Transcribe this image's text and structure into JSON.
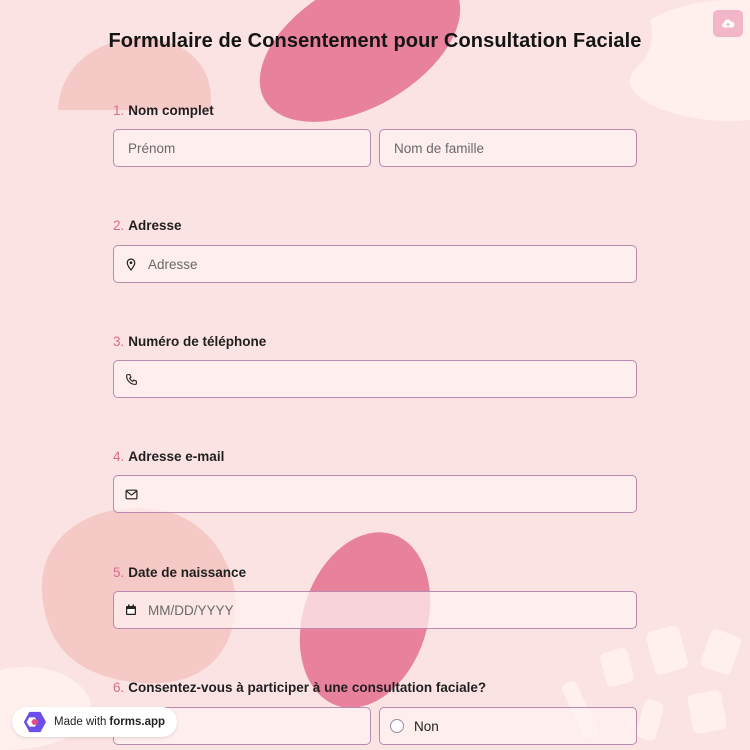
{
  "form": {
    "title": "Formulaire de Consentement pour Consultation Faciale",
    "questions": [
      {
        "number": "1.",
        "label": "Nom complet",
        "fields": [
          {
            "placeholder": "Prénom"
          },
          {
            "placeholder": "Nom de famille"
          }
        ]
      },
      {
        "number": "2.",
        "label": "Adresse",
        "fields": [
          {
            "placeholder": "Adresse",
            "icon": "location-pin-icon"
          }
        ]
      },
      {
        "number": "3.",
        "label": "Numéro de téléphone",
        "fields": [
          {
            "placeholder": "",
            "icon": "phone-icon"
          }
        ]
      },
      {
        "number": "4.",
        "label": "Adresse e-mail",
        "fields": [
          {
            "placeholder": "",
            "icon": "envelope-icon"
          }
        ]
      },
      {
        "number": "5.",
        "label": "Date de naissance",
        "fields": [
          {
            "placeholder": "MM/DD/YYYY",
            "icon": "calendar-icon"
          }
        ]
      },
      {
        "number": "6.",
        "label": "Consentez-vous à participer à une consultation faciale?",
        "options": [
          {
            "label": ""
          },
          {
            "label": "Non"
          }
        ]
      }
    ]
  },
  "toolbar": {
    "upload_icon": "cloud-upload-icon"
  },
  "badge": {
    "prefix": "Made with",
    "brand": "forms.app",
    "logo_icon": "forms-app-logo-icon"
  },
  "colors": {
    "background": "#fce3e3",
    "accent": "#e47a97",
    "number": "#d96b8f",
    "field_border": "#b98ab0"
  }
}
